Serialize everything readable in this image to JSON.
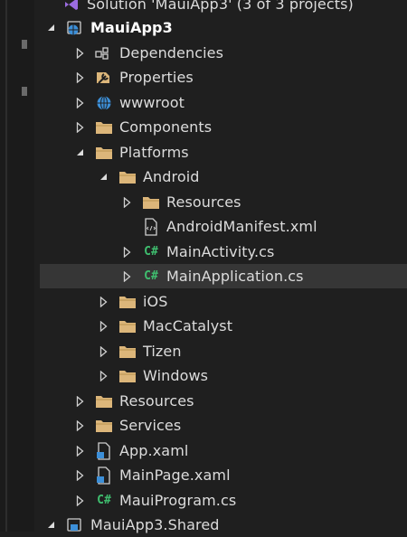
{
  "solution_title": "Solution 'MauiApp3' (3 of 3 projects)",
  "project": "MauiApp3",
  "items": {
    "dependencies": "Dependencies",
    "properties": "Properties",
    "wwwroot": "wwwroot",
    "components": "Components",
    "platforms": "Platforms",
    "android": "Android",
    "android_resources": "Resources",
    "android_manifest": "AndroidManifest.xml",
    "main_activity": "MainActivity.cs",
    "main_application": "MainApplication.cs",
    "ios": "iOS",
    "maccatalyst": "MacCatalyst",
    "tizen": "Tizen",
    "windows": "Windows",
    "resources": "Resources",
    "services": "Services",
    "app_xaml": "App.xaml",
    "mainpage_xaml": "MainPage.xaml",
    "mauiprogram": "MauiProgram.cs"
  },
  "shared_project": "MauiApp3.Shared",
  "cs_glyph": "C#",
  "colors": {
    "background": "#1f1f1f",
    "selection": "#363636",
    "folder": "#dcb67a",
    "csharp": "#3fbf6f",
    "project_icon": "#3c8fd8"
  }
}
